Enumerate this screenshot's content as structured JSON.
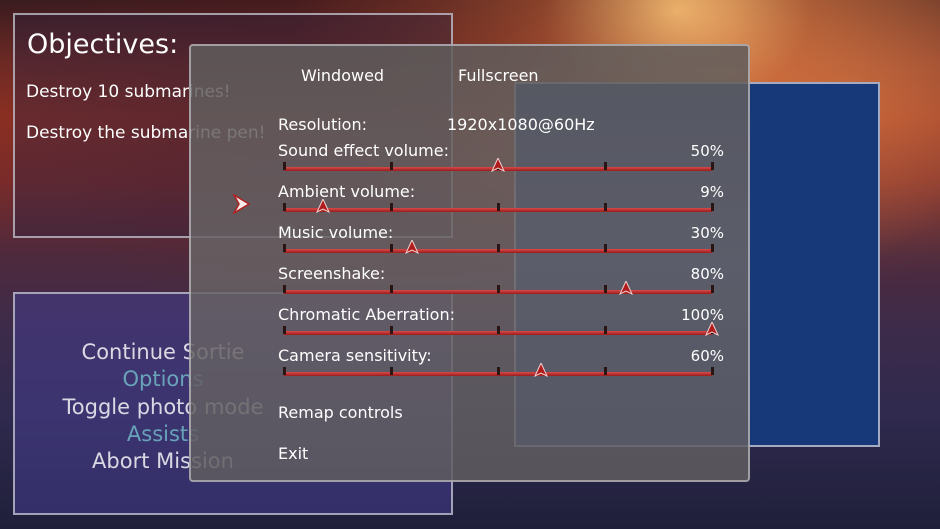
{
  "objectives": {
    "title": "Objectives:",
    "items": [
      "Destroy 10 submarines!",
      "Destroy the submarine pen!"
    ]
  },
  "pause_menu": {
    "items": [
      "Continue Sortie",
      "Options",
      "Toggle photo mode",
      "Assists",
      "Abort Mission"
    ]
  },
  "options": {
    "tabs": {
      "windowed": "Windowed",
      "fullscreen": "Fullscreen"
    },
    "resolution": {
      "label": "Resolution:",
      "value": "1920x1080@60Hz"
    },
    "sliders": [
      {
        "label": "Sound effect volume:",
        "value_text": "50%",
        "value": 0.5
      },
      {
        "label": "Ambient volume:",
        "value_text": "9%",
        "value": 0.09
      },
      {
        "label": "Music volume:",
        "value_text": "30%",
        "value": 0.3
      },
      {
        "label": "Screenshake:",
        "value_text": "80%",
        "value": 0.8
      },
      {
        "label": "Chromatic Aberration:",
        "value_text": "100%",
        "value": 1.0
      },
      {
        "label": "Camera sensitivity:",
        "value_text": "60%",
        "value": 0.6
      }
    ],
    "remap": "Remap controls",
    "exit": "Exit"
  },
  "colors": {
    "slider": "#c22a2a",
    "right_panel": "#17397a"
  }
}
